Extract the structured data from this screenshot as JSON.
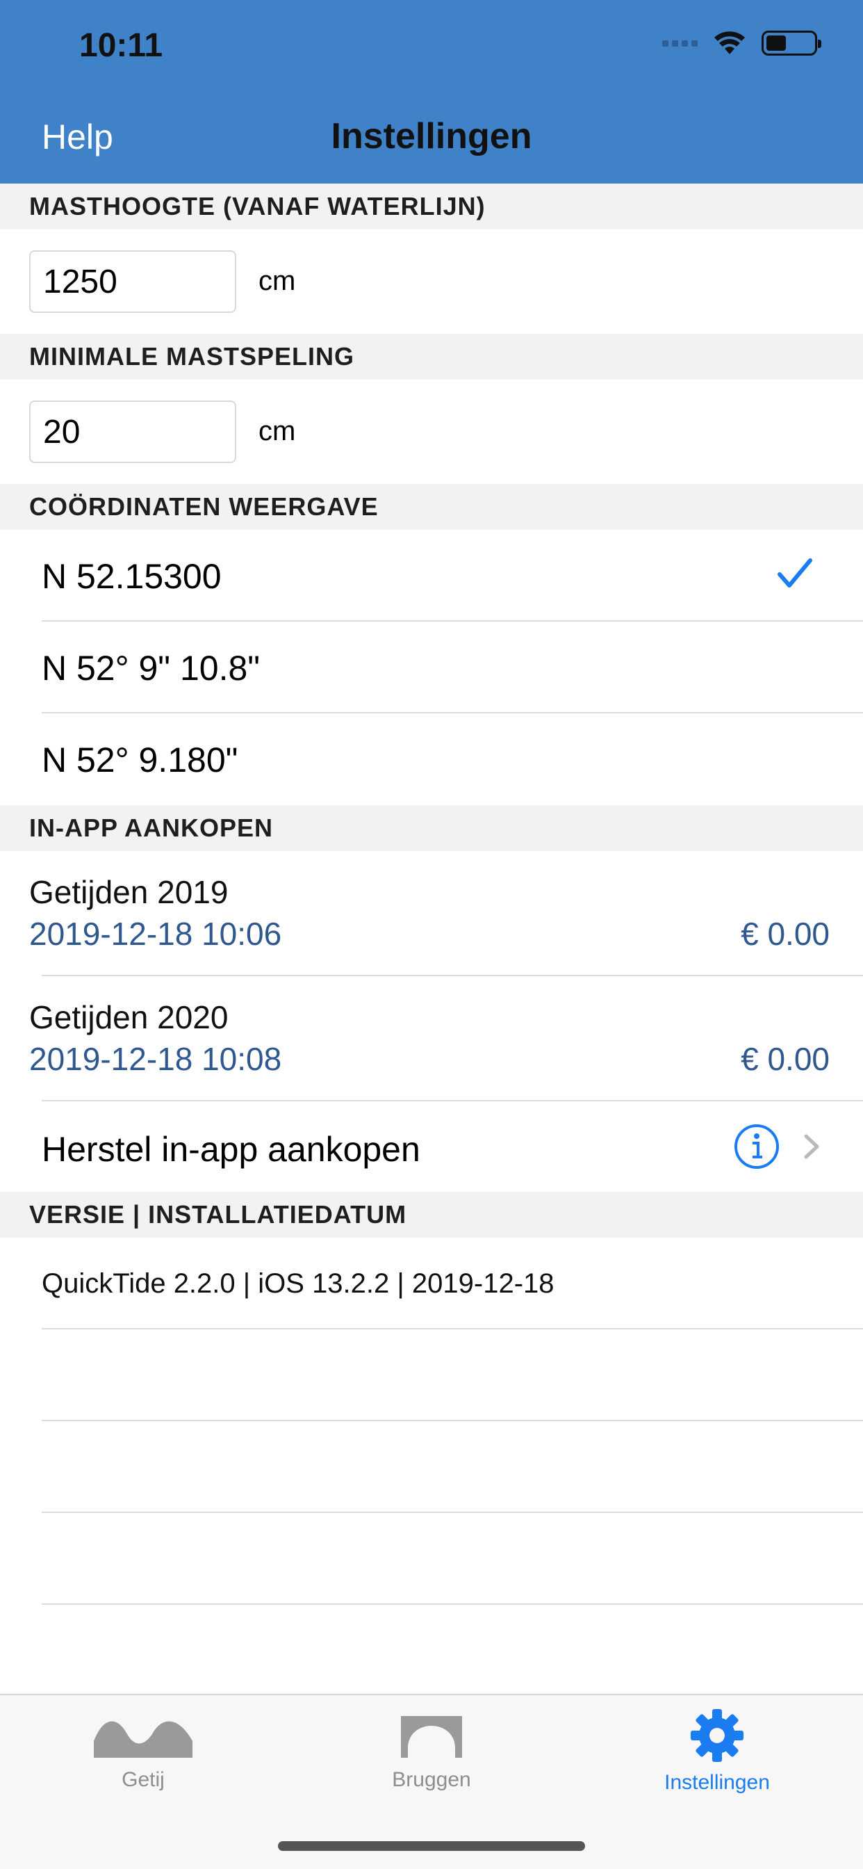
{
  "status_bar": {
    "time": "10:11"
  },
  "nav": {
    "left_button": "Help",
    "title": "Instellingen"
  },
  "sections": {
    "mast_height": {
      "header": "MASTHOOGTE (VANAF WATERLIJN)",
      "value": "1250",
      "unit": "cm"
    },
    "min_clearance": {
      "header": "MINIMALE MASTSPELING",
      "value": "20",
      "unit": "cm"
    },
    "coordinates": {
      "header": "COÖRDINATEN WEERGAVE",
      "options": [
        {
          "label": "N 52.15300",
          "selected": true
        },
        {
          "label": "N 52° 9\" 10.8\"",
          "selected": false
        },
        {
          "label": "N 52° 9.180\"",
          "selected": false
        }
      ]
    },
    "purchases": {
      "header": "IN-APP AANKOPEN",
      "items": [
        {
          "title": "Getijden 2019",
          "date": "2019-12-18 10:06",
          "price": "€ 0.00"
        },
        {
          "title": "Getijden 2020",
          "date": "2019-12-18 10:08",
          "price": "€ 0.00"
        }
      ],
      "restore_label": "Herstel in-app aankopen"
    },
    "version": {
      "header": "VERSIE  |  INSTALLATIEDATUM",
      "text": "QuickTide 2.2.0  |  iOS 13.2.2  |  2019-12-18"
    }
  },
  "tabs": [
    {
      "label": "Getij",
      "icon": "wave-icon",
      "active": false
    },
    {
      "label": "Bruggen",
      "icon": "bridge-icon",
      "active": false
    },
    {
      "label": "Instellingen",
      "icon": "gear-icon",
      "active": true
    }
  ],
  "colors": {
    "nav_background": "#3f82c8",
    "accent": "#1a7cf0",
    "purchase_text": "#2f5790"
  }
}
